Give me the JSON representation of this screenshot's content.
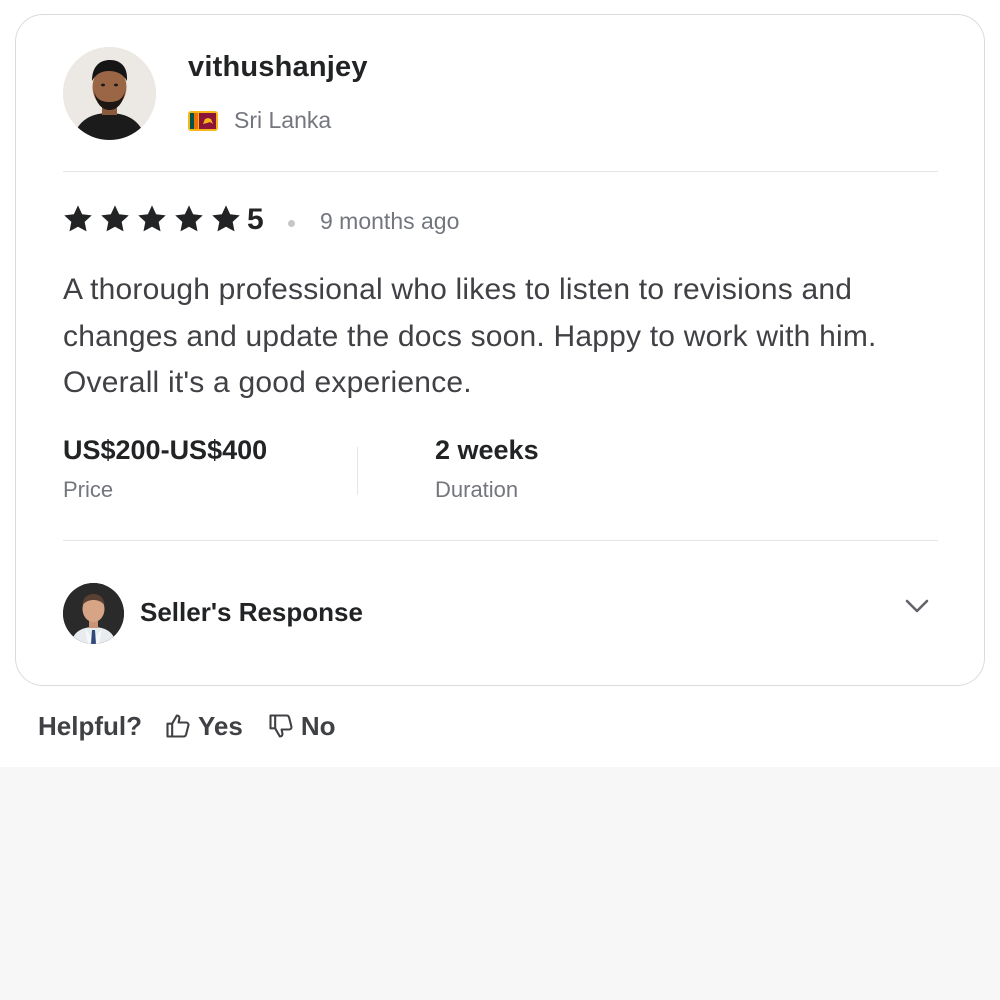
{
  "reviewer": {
    "name": "vithushanjey",
    "country": "Sri Lanka",
    "avatar_icon": "person-avatar",
    "flag_icon": "sri-lanka-flag-icon"
  },
  "review": {
    "rating": "5",
    "rating_stars": 5,
    "time_ago": "9 months ago",
    "text": "A thorough professional who likes to listen to revisions and changes and update the docs soon. Happy to work with him. Overall it's a good experience.",
    "price_value": "US$200-US$400",
    "price_label": "Price",
    "duration_value": "2 weeks",
    "duration_label": "Duration"
  },
  "seller_response": {
    "label": "Seller's Response",
    "avatar_icon": "seller-avatar",
    "expand_icon": "chevron-down-icon"
  },
  "helpful": {
    "label": "Helpful?",
    "yes_label": "Yes",
    "no_label": "No"
  },
  "colors": {
    "star": "#222325",
    "text": "#404145",
    "muted": "#74767e",
    "border": "#dadbdd"
  }
}
